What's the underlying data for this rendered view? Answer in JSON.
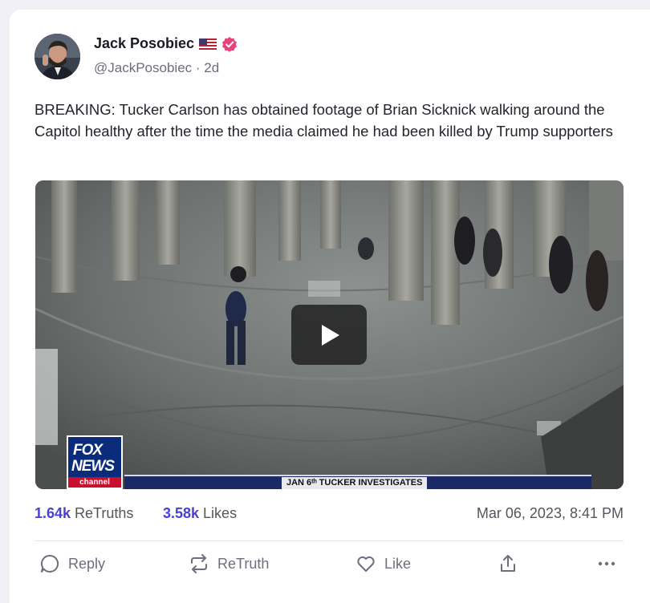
{
  "post": {
    "author_name": "Jack Posobiec",
    "handle": "@JackPosobiec",
    "separator": " · ",
    "age": "2d",
    "text": "BREAKING: Tucker Carlson has obtained footage of Brian Sicknick walking around the Capitol healthy after the time the media claimed he had been killed by Trump supporters"
  },
  "video": {
    "network_logo": [
      "FOX",
      "NEWS",
      "channel"
    ],
    "lower_third": "JAN 6ᵗʰ TUCKER INVESTIGATES",
    "play_icon": "play-icon"
  },
  "stats": {
    "retruths_count": "1.64k",
    "retruths_label": "ReTruths",
    "likes_count": "3.58k",
    "likes_label": "Likes",
    "timestamp": "Mar 06, 2023, 8:41 PM"
  },
  "actions": {
    "reply": "Reply",
    "retruth": "ReTruth",
    "like": "Like"
  },
  "colors": {
    "accent": "#4a3fd4",
    "verified": "#e5457a",
    "text": "#24242c",
    "muted": "#6e6e7c"
  },
  "icons": [
    "flag-us-icon",
    "verified-badge-icon",
    "play-icon",
    "reply-icon",
    "retruth-icon",
    "like-icon",
    "share-icon",
    "more-icon"
  ]
}
